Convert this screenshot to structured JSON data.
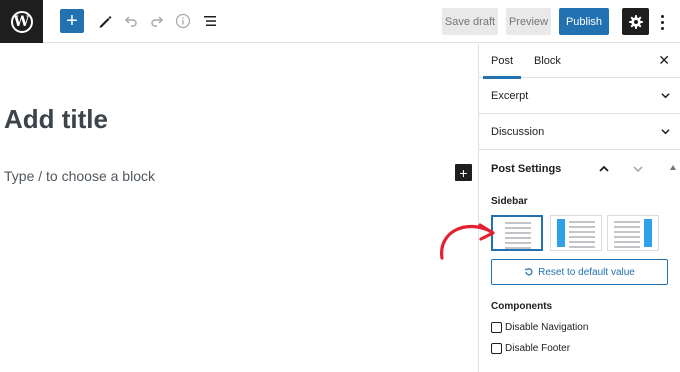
{
  "toolbar": {
    "save_draft": "Save draft",
    "preview": "Preview",
    "publish": "Publish",
    "icons": [
      "wordpress-logo",
      "add",
      "pen",
      "undo",
      "redo",
      "info",
      "list-view",
      "settings-gear",
      "more-vertical"
    ]
  },
  "editor": {
    "title_placeholder": "Add title",
    "block_placeholder": "Type / to choose a block"
  },
  "sidebar": {
    "tabs": [
      "Post",
      "Block"
    ],
    "active_tab": "Post",
    "panels": [
      "Excerpt",
      "Discussion"
    ],
    "post_settings": {
      "title": "Post Settings",
      "sidebar_label": "Sidebar",
      "layout_options": [
        "no-sidebar",
        "left-sidebar",
        "right-sidebar"
      ],
      "selected_layout": "no-sidebar",
      "reset_label": "Reset to default value",
      "components_label": "Components",
      "components": [
        {
          "label": "Disable Navigation",
          "checked": false
        },
        {
          "label": "Disable Footer",
          "checked": false
        }
      ]
    }
  },
  "colors": {
    "accent": "#2271b1",
    "annotation_arrow": "#e2212f",
    "dark": "#1e1e1e"
  }
}
